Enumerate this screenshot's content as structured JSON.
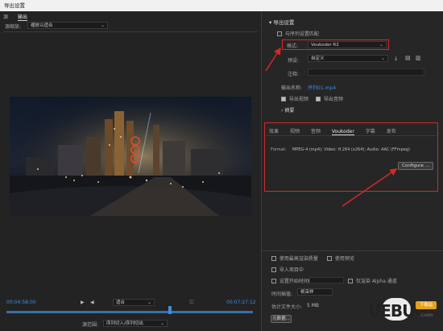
{
  "window": {
    "title": "导出设置"
  },
  "left_tabs": [
    "源",
    "输出"
  ],
  "source": {
    "label": "源缩放:",
    "value": "缩放以适合"
  },
  "timeline": {
    "start_time": "00:04:58:00",
    "end_time": "00:07:27:12",
    "fit_label": "适合",
    "range_label": "源范围:",
    "range_value": "序列切入/序列切出"
  },
  "export": {
    "section_title": "导出设置",
    "match_sequence_label": "与序列设置匹配",
    "format_label": "格式:",
    "format_value": "Voukoder R2",
    "preset_label": "预设:",
    "preset_value": "自定义",
    "comments_label": "注释:",
    "output_name_label": "输出名称:",
    "output_name_value": "序列01.mp4",
    "export_video_label": "导出视频",
    "export_audio_label": "导出音频",
    "summary_label": "摘要"
  },
  "sub_tabs": [
    "效果",
    "视频",
    "音频",
    "Voukoder",
    "字幕",
    "发布"
  ],
  "voukoder": {
    "format_label": "Format:",
    "format_text": "MPEG-4 (mp4); Video: H.264 (x264); Audio: AAC (FFmpeg)",
    "configure_label": "Configure ..."
  },
  "bottom_options": {
    "max_render_quality": "使用最高渲染质量",
    "use_previews": "使用预览",
    "import_into_project": "导入项目中",
    "set_start_timecode": "设置开始时间码",
    "render_alpha": "仅渲染 Alpha 通道",
    "time_interp_label": "时间插值:",
    "time_interp_value": "帧采样",
    "file_size_label": "估计文件大小:",
    "file_size_value": "5 MB",
    "metadata_button": "元数据..."
  },
  "watermark": {
    "text": "UEBUG",
    "sub": "下载站",
    "domain": ".com"
  },
  "colors": {
    "accent_blue": "#3b8fdc",
    "annotation_red": "#d12a2a"
  }
}
